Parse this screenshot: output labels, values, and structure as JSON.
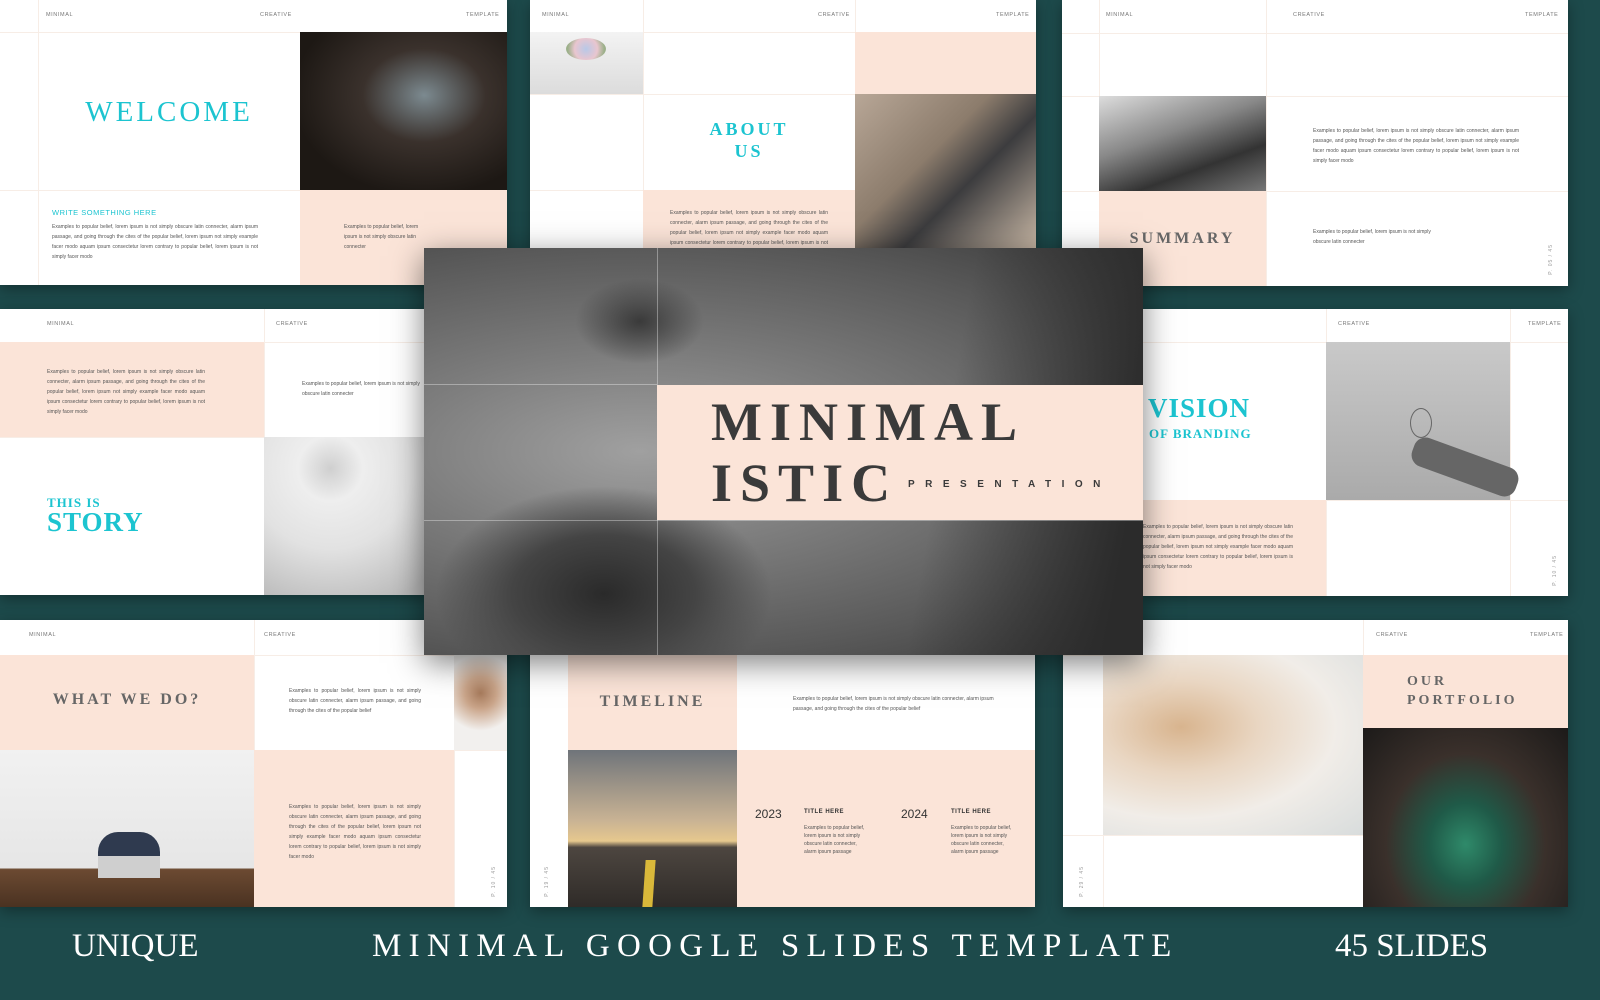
{
  "common": {
    "h1": "MINIMAL",
    "h2": "CREATIVE",
    "h3": "TEMPLATE",
    "lorem_long": "Examples to popular belief, lorem ipsum is not simply obscure latin connecter, alarm ipsum passage, and going through the cites of the popular belief, lorem ipsum not simply example facer modo aquam ipsum consectetur lorem contrary to popular belief, lorem ipsum is not simply facer modo",
    "lorem_short": "Examples to popular belief, lorem ipsum is not simply obscure latin connecter",
    "lorem_two": "Examples to popular belief, lorem ipsum is not simply obscure latin connecter, alarm ipsum passage, and going through the cites of the popular belief"
  },
  "welcome": {
    "title": "WELCOME",
    "subtitle": "WRITE SOMETHING HERE"
  },
  "about": {
    "title_1": "ABOUT",
    "title_2": "US"
  },
  "summary": {
    "title": "SUMMARY",
    "page": "P. 05 / 45"
  },
  "story": {
    "pre": "THIS IS",
    "title": "STORY"
  },
  "vision": {
    "title": "VISION",
    "subtitle": "OF BRANDING",
    "page": "P. 10 / 45"
  },
  "whatwedo": {
    "title": "WHAT WE DO?",
    "page": "P. 10 / 45"
  },
  "timeline": {
    "title": "TIMELINE",
    "page": "P. 19 / 45",
    "items": [
      {
        "year": "2023",
        "title": "TITLE HERE",
        "text": "Examples to popular belief, lorem ipsum is not simply obscure latin connecter, alarm ipsum passage"
      },
      {
        "year": "2024",
        "title": "TITLE HERE",
        "text": "Examples to popular belief, lorem ipsum is not simply obscure latin connecter, alarm ipsum passage"
      }
    ]
  },
  "portfolio": {
    "title_1": "OUR",
    "title_2": "PORTFOLIO",
    "page": "P. 29 / 45"
  },
  "cover": {
    "line1": "MINIMAL",
    "line2": "ISTIC",
    "tag": "PRESENTATION"
  },
  "banner": {
    "left": "UNIQUE",
    "center": "MINIMAL GOOGLE SLIDES TEMPLATE",
    "right": "45 SLIDES"
  },
  "colors": {
    "background": "#1d4a4b",
    "accent": "#1cc4d0",
    "peach": "#fbe4d8",
    "title_grey": "#666666"
  }
}
